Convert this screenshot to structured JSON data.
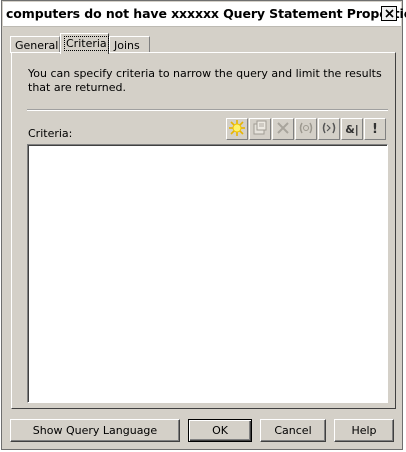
{
  "window": {
    "title": "computers do not have xxxxxx Query Statement Properties",
    "close_icon": "close-icon"
  },
  "tabs": [
    {
      "label": "General",
      "active": false
    },
    {
      "label": "Criteria",
      "active": true
    },
    {
      "label": "Joins",
      "active": false
    }
  ],
  "criteria_tab": {
    "description": "You can specify criteria to narrow the query and limit the results that are returned.",
    "criteria_label": "Criteria:",
    "toolbar_icons": [
      "new-criterion-icon",
      "properties-icon",
      "delete-icon",
      "group-icon",
      "ungroup-icon",
      "and-or-icon",
      "not-icon"
    ],
    "and_or_text": "&|",
    "not_text": "!",
    "items": []
  },
  "buttons": {
    "show_query_language": "Show Query Language",
    "ok": "OK",
    "cancel": "Cancel",
    "help": "Help"
  }
}
